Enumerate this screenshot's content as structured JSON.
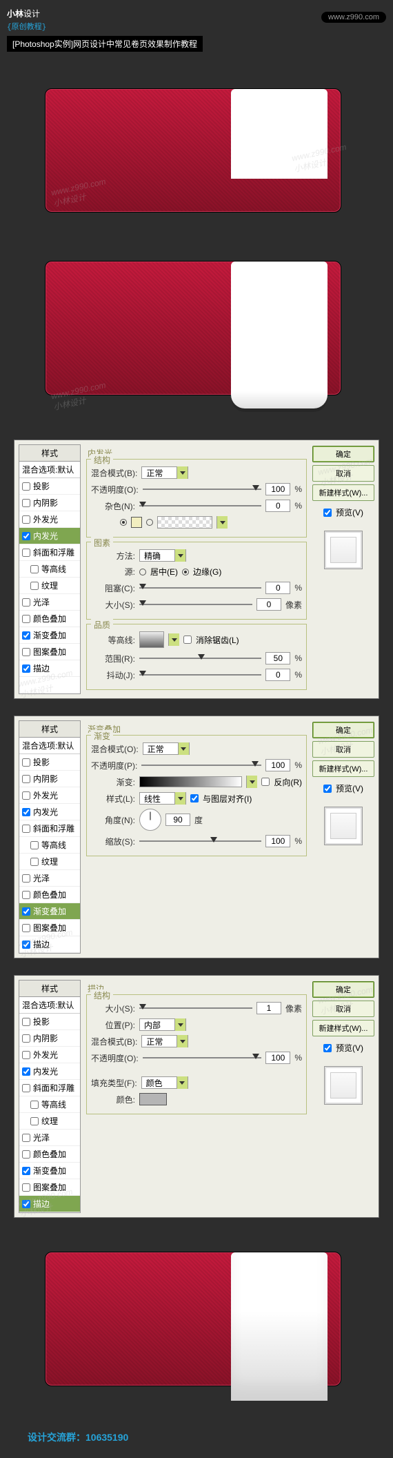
{
  "header": {
    "logo_main": "小林",
    "logo_thin": "设计",
    "logo_sub": "{原创教程}",
    "url": "www.z990.com",
    "title": "[Photoshop实例]网页设计中常见卷页效果制作教程"
  },
  "watermark": {
    "url": "www.z990.com",
    "name": "小林设计"
  },
  "styles_list": {
    "title": "样式",
    "blend": "混合选项:默认",
    "items": [
      {
        "label": "投影",
        "checked": false
      },
      {
        "label": "内阴影",
        "checked": false
      },
      {
        "label": "外发光",
        "checked": false
      },
      {
        "label": "内发光",
        "checked": true
      },
      {
        "label": "斜面和浮雕",
        "checked": false
      },
      {
        "label": "等高线",
        "checked": false,
        "indent": true
      },
      {
        "label": "纹理",
        "checked": false,
        "indent": true
      },
      {
        "label": "光泽",
        "checked": false
      },
      {
        "label": "颜色叠加",
        "checked": false
      },
      {
        "label": "渐变叠加",
        "checked": true
      },
      {
        "label": "图案叠加",
        "checked": false
      },
      {
        "label": "描边",
        "checked": true
      }
    ]
  },
  "buttons": {
    "ok": "确定",
    "cancel": "取消",
    "new_style": "新建样式(W)...",
    "preview": "预览(V)"
  },
  "panel1": {
    "title": "内发光",
    "g1_title": "结构",
    "blend_mode_lbl": "混合模式(B):",
    "blend_mode_val": "正常",
    "opacity_lbl": "不透明度(O):",
    "opacity_val": "100",
    "opacity_unit": "%",
    "noise_lbl": "杂色(N):",
    "noise_val": "0",
    "noise_unit": "%",
    "g2_title": "图素",
    "technique_lbl": "方法:",
    "technique_val": "精确",
    "source_lbl": "源:",
    "center_lbl": "居中(E)",
    "edge_lbl": "边缘(G)",
    "choke_lbl": "阻塞(C):",
    "choke_val": "0",
    "choke_unit": "%",
    "size_lbl": "大小(S):",
    "size_val": "0",
    "size_unit": "像素",
    "g3_title": "品质",
    "contour_lbl": "等高线:",
    "antialias_lbl": "消除锯齿(L)",
    "range_lbl": "范围(R):",
    "range_val": "50",
    "range_unit": "%",
    "jitter_lbl": "抖动(J):",
    "jitter_val": "0",
    "jitter_unit": "%"
  },
  "panel2": {
    "title": "渐变叠加",
    "g_title": "渐变",
    "blend_mode_lbl": "混合模式(O):",
    "blend_mode_val": "正常",
    "opacity_lbl": "不透明度(P):",
    "opacity_val": "100",
    "opacity_unit": "%",
    "gradient_lbl": "渐变:",
    "reverse_lbl": "反向(R)",
    "style_lbl": "样式(L):",
    "style_val": "线性",
    "align_lbl": "与图层对齐(I)",
    "angle_lbl": "角度(N):",
    "angle_val": "90",
    "angle_unit": "度",
    "scale_lbl": "缩放(S):",
    "scale_val": "100",
    "scale_unit": "%"
  },
  "panel3": {
    "title": "描边",
    "g_title": "结构",
    "size_lbl": "大小(S):",
    "size_val": "1",
    "size_unit": "像素",
    "position_lbl": "位置(P):",
    "position_val": "内部",
    "blend_mode_lbl": "混合模式(B):",
    "blend_mode_val": "正常",
    "opacity_lbl": "不透明度(O):",
    "opacity_val": "100",
    "opacity_unit": "%",
    "fill_type_lbl": "填充类型(F):",
    "fill_type_val": "颜色",
    "color_lbl": "颜色:"
  },
  "footer": {
    "text": "设计交流群：10635190"
  }
}
